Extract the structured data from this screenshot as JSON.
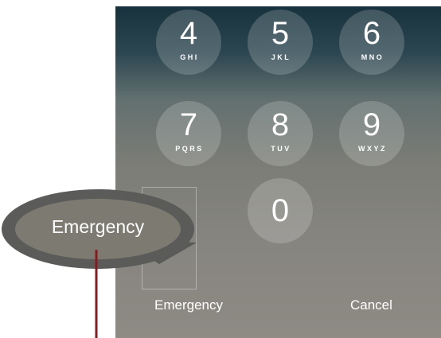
{
  "keypad": {
    "keys": [
      {
        "digit": "4",
        "letters": "GHI"
      },
      {
        "digit": "5",
        "letters": "JKL"
      },
      {
        "digit": "6",
        "letters": "MNO"
      },
      {
        "digit": "7",
        "letters": "PQRS"
      },
      {
        "digit": "8",
        "letters": "TUV"
      },
      {
        "digit": "9",
        "letters": "WXYZ"
      },
      {
        "digit": "0",
        "letters": ""
      }
    ]
  },
  "footer": {
    "emergency_label": "Emergency",
    "cancel_label": "Cancel"
  },
  "callout": {
    "label": "Emergency",
    "pointer_color": "#8b1a1f"
  }
}
